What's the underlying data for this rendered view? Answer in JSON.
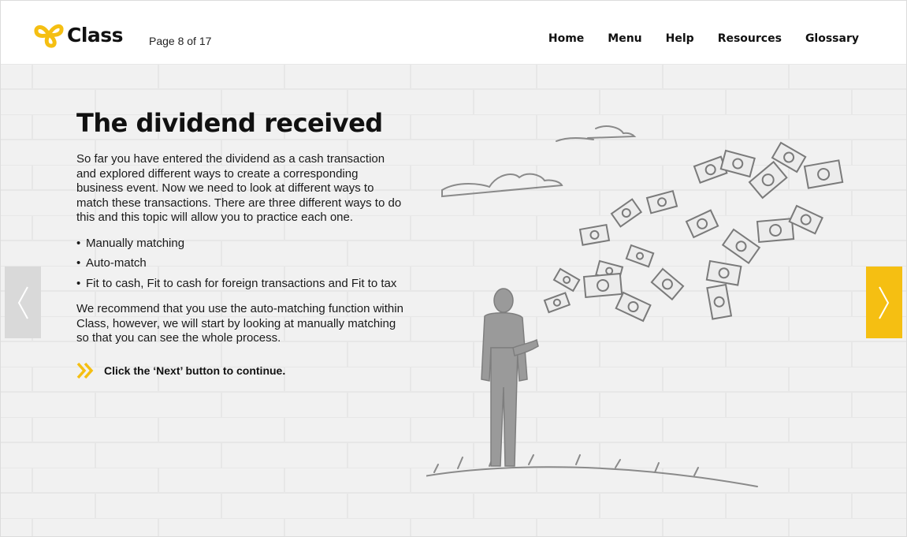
{
  "header": {
    "logo_text": "Class",
    "page_indicator": "Page 8 of 17",
    "nav": [
      "Home",
      "Menu",
      "Help",
      "Resources",
      "Glossary"
    ]
  },
  "main": {
    "title": "The dividend received",
    "intro": "So far you have entered the dividend as a cash transaction and explored different ways to create a corresponding business event. Now we need to look at different ways to match these transactions. There are three different ways to do this and this topic will allow you to practice each one.",
    "bullets": [
      "Manually matching",
      "Auto-match",
      "Fit to cash, Fit to cash for foreign transactions and Fit to tax"
    ],
    "recommendation": "We recommend that you use the auto-matching function within Class, however, we will start by looking at manually matching so that you can see the whole process.",
    "cta": "Click the ‘Next’ button to continue."
  },
  "icons": {
    "logo": "class-logo-icon",
    "cta": "double-chevron-right-icon",
    "prev": "chevron-left-icon",
    "next": "chevron-right-icon"
  },
  "colors": {
    "accent": "#f5bf12",
    "prev_bg": "#d9d9d9",
    "background": "#f1f1f1",
    "illustration": "#8a8a8a"
  }
}
